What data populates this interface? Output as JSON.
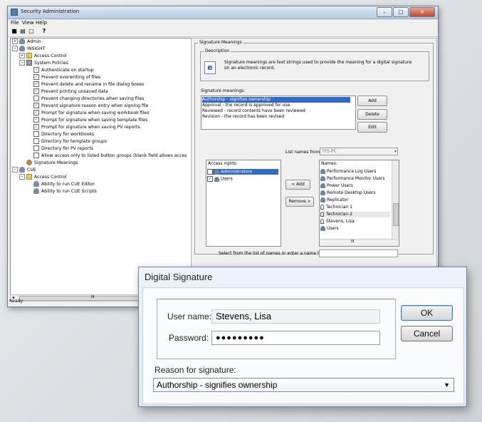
{
  "window": {
    "title": "Security Administration",
    "menu": [
      "File",
      "View",
      "Help"
    ],
    "toolbar_icons": [
      "save-icon",
      "print-icon",
      "print-preview-icon",
      "help-icon"
    ],
    "status": "Ready",
    "scroll_thumb_label": "III"
  },
  "tree": [
    {
      "label": "Admin",
      "icon": "user"
    },
    {
      "label": "INSIGHT",
      "icon": "user"
    },
    {
      "label": "Access Control",
      "icon": "folder"
    },
    {
      "label": "System Policies",
      "icon": "policy"
    },
    {
      "label": "Authenticate on startup",
      "icon": "checkbox"
    },
    {
      "label": "Prevent overwriting of files",
      "icon": "checkbox"
    },
    {
      "label": "Prevent delete and rename in file dialog boxes",
      "icon": "checkbox"
    },
    {
      "label": "Prevent printing unsaved data",
      "icon": "checkbox"
    },
    {
      "label": "Prevent changing directories when saving files",
      "icon": "checkbox"
    },
    {
      "label": "Prevent signature reason entry when signing file",
      "icon": "checkbox"
    },
    {
      "label": "Prompt for signature when saving workbook files",
      "icon": "checkbox"
    },
    {
      "label": "Prompt for signature when saving template files",
      "icon": "checkbox"
    },
    {
      "label": "Prompt for signature when saving PV reports",
      "icon": "checkbox"
    },
    {
      "label": "Directory for workbooks",
      "icon": "list"
    },
    {
      "label": "Directory for template groups",
      "icon": "list"
    },
    {
      "label": "Directory for PV reports",
      "icon": "list"
    },
    {
      "label": "Allow access only to listed button groups (blank field allows acces",
      "icon": "list"
    },
    {
      "label": "Signature Meanings",
      "icon": "key"
    },
    {
      "label": "CUE",
      "icon": "user"
    },
    {
      "label": "Access Control",
      "icon": "folder"
    },
    {
      "label": "Ability to run CUE Editor",
      "icon": "user"
    },
    {
      "label": "Ability to run CUE Scripts",
      "icon": "user"
    }
  ],
  "panel": {
    "group_caption": "Signature Meanings",
    "description_caption": "Description",
    "description_text": "Signature meanings are text strings used to provide the meaning for a digital signature on an electronic record.",
    "meanings_label": "Signature meanings:",
    "meanings": [
      "Authorship - signifies ownership",
      "Approval - the record is approved for use",
      "Reviewed - record contents have been reviewed",
      "Revision - the record has been revised"
    ],
    "buttons": {
      "add": "Add",
      "delete": "Delete",
      "edit": "Edit",
      "add_left": "< Add",
      "remove": "Remove >"
    },
    "list_names_from_label": "List names from:",
    "list_names_from_value": "TFS-PC",
    "access_rights_label": "Access rights:",
    "access_rights": [
      "Administrators",
      "Users"
    ],
    "names_label": "Names:",
    "names": [
      "Performance Log Users",
      "Performance Monitor Users",
      "Power Users",
      "Remote Desktop Users",
      "Replicator",
      "Technician 1",
      "Technician 2",
      "Stevens, Lisa",
      "Users"
    ],
    "names_scroll_label": "III",
    "select_hint": "Select from the list of names or enter a name here:"
  },
  "dialog": {
    "title": "Digital Signature",
    "username_label": "User name:",
    "username_value": "Stevens, Lisa",
    "password_label": "Password:",
    "password_value": "●●●●●●●●●",
    "ok_label": "OK",
    "cancel_label": "Cancel",
    "reason_label": "Reason for signature:",
    "reason_value": "Authorship - signifies ownership"
  }
}
